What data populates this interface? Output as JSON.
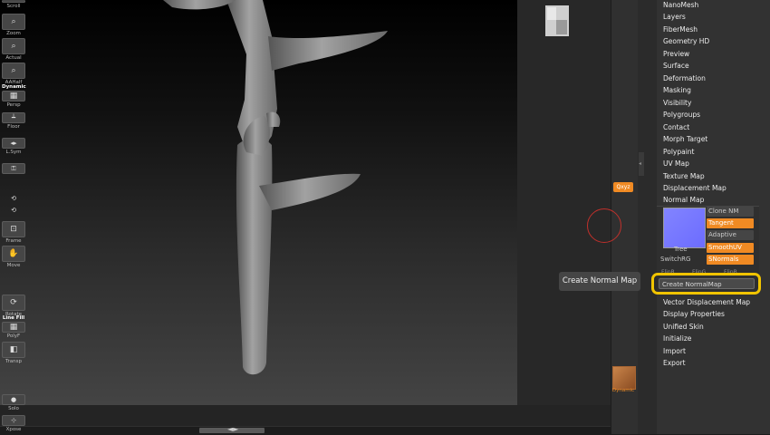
{
  "shelf": {
    "scroll": "Scroll",
    "zoom": "Zoom",
    "actual": "Actual",
    "aahalf": "AAHalf",
    "dynamic": "Dynamic",
    "persp": "Persp",
    "floor": "Floor",
    "lsym": "L.Sym",
    "xyz": "Qxyz",
    "frame": "Frame",
    "move": "Move",
    "rotate": "Rotate",
    "linefill": "Line Fill",
    "polyf": "PolyF",
    "transp": "Transp",
    "dynamic2": "Dynamic",
    "solo": "Solo",
    "xpose": "Xpose"
  },
  "tooltip": "Create Normal Map",
  "menu": {
    "top_items": [
      "NanoMesh",
      "Layers",
      "FiberMesh",
      "Geometry HD",
      "Preview",
      "Surface",
      "Deformation",
      "Masking",
      "Visibility",
      "Polygroups",
      "Contact",
      "Morph Target",
      "Polypaint",
      "UV Map",
      "Texture Map",
      "Displacement Map",
      "Normal Map"
    ],
    "bottom_items": [
      "Vector Displacement Map",
      "Display Properties",
      "Unified Skin",
      "Initialize",
      "Import",
      "Export"
    ]
  },
  "normal_map": {
    "preview_label": "Tree",
    "clone_nm": "Clone NM",
    "tangent": "Tangent",
    "adaptive": "Adaptive",
    "smooth_uv": "SmoothUV",
    "snormals": "SNormals",
    "switch_rg": "SwitchRG",
    "flip_labels": [
      "FlipR",
      "FlipG",
      "FlipB"
    ],
    "create_button": "Create NormalMap"
  },
  "colors": {
    "accent": "#f08a23",
    "highlight": "#f1c400",
    "normal_map_preview": "#7a7aff"
  }
}
